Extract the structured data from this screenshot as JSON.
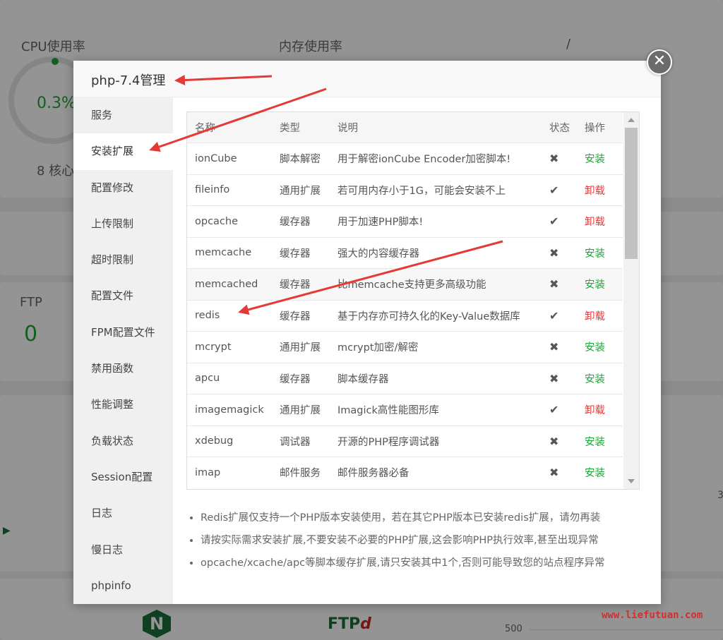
{
  "background": {
    "cpu_label": "CPU使用率",
    "cpu_value": "0.3%",
    "cpu_cores": "8 核心",
    "mem_label": "内存使用率",
    "disk_label": "/",
    "ftp_label": "FTP",
    "ftp_count": "0",
    "nginx_icon": "N",
    "ftp_logo_text": "FTP",
    "ftp_logo_mark": "d",
    "axis_tick": "500",
    "side_number": "3"
  },
  "modal": {
    "title": "php-7.4管理",
    "close_icon": "close-icon"
  },
  "sidebar": {
    "items": [
      {
        "label": "服务"
      },
      {
        "label": "安装扩展"
      },
      {
        "label": "配置修改"
      },
      {
        "label": "上传限制"
      },
      {
        "label": "超时限制"
      },
      {
        "label": "配置文件"
      },
      {
        "label": "FPM配置文件"
      },
      {
        "label": "禁用函数"
      },
      {
        "label": "性能调整"
      },
      {
        "label": "负载状态"
      },
      {
        "label": "Session配置"
      },
      {
        "label": "日志"
      },
      {
        "label": "慢日志"
      },
      {
        "label": "phpinfo"
      }
    ],
    "active_index": 1
  },
  "table": {
    "headers": {
      "name": "名称",
      "type": "类型",
      "desc": "说明",
      "status": "状态",
      "action": "操作"
    },
    "rows": [
      {
        "name": "ionCube",
        "type": "脚本解密",
        "desc": "用于解密ionCube Encoder加密脚本!",
        "status": "✖",
        "action": "安装"
      },
      {
        "name": "fileinfo",
        "type": "通用扩展",
        "desc": "若可用内存小于1G，可能会安装不上",
        "status": "✔",
        "action": "卸载"
      },
      {
        "name": "opcache",
        "type": "缓存器",
        "desc": "用于加速PHP脚本!",
        "status": "✔",
        "action": "卸载"
      },
      {
        "name": "memcache",
        "type": "缓存器",
        "desc": "强大的内容缓存器",
        "status": "✖",
        "action": "安装"
      },
      {
        "name": "memcached",
        "type": "缓存器",
        "desc": "比memcache支持更多高级功能",
        "status": "✖",
        "action": "安装"
      },
      {
        "name": "redis",
        "type": "缓存器",
        "desc": "基于内存亦可持久化的Key-Value数据库",
        "status": "✔",
        "action": "卸载"
      },
      {
        "name": "mcrypt",
        "type": "通用扩展",
        "desc": "mcrypt加密/解密",
        "status": "✖",
        "action": "安装"
      },
      {
        "name": "apcu",
        "type": "缓存器",
        "desc": "脚本缓存器",
        "status": "✖",
        "action": "安装"
      },
      {
        "name": "imagemagick",
        "type": "通用扩展",
        "desc": "Imagick高性能图形库",
        "status": "✔",
        "action": "卸载"
      },
      {
        "name": "xdebug",
        "type": "调试器",
        "desc": "开源的PHP程序调试器",
        "status": "✖",
        "action": "安装"
      },
      {
        "name": "imap",
        "type": "邮件服务",
        "desc": "邮件服务器必备",
        "status": "✖",
        "action": "安装"
      }
    ]
  },
  "notes": [
    "Redis扩展仅支持一个PHP版本安装使用，若在其它PHP版本已安装redis扩展，请勿再装",
    "请按实际需求安装扩展,不要安装不必要的PHP扩展,这会影响PHP执行效率,甚至出现异常",
    "opcache/xcache/apc等脚本缓存扩展,请只安装其中1个,否则可能导致您的站点程序异常"
  ],
  "watermark": "www.liefutuan.com",
  "colors": {
    "install": "#20a53a",
    "uninstall": "#e23b3b",
    "arrow": "#e53935"
  }
}
